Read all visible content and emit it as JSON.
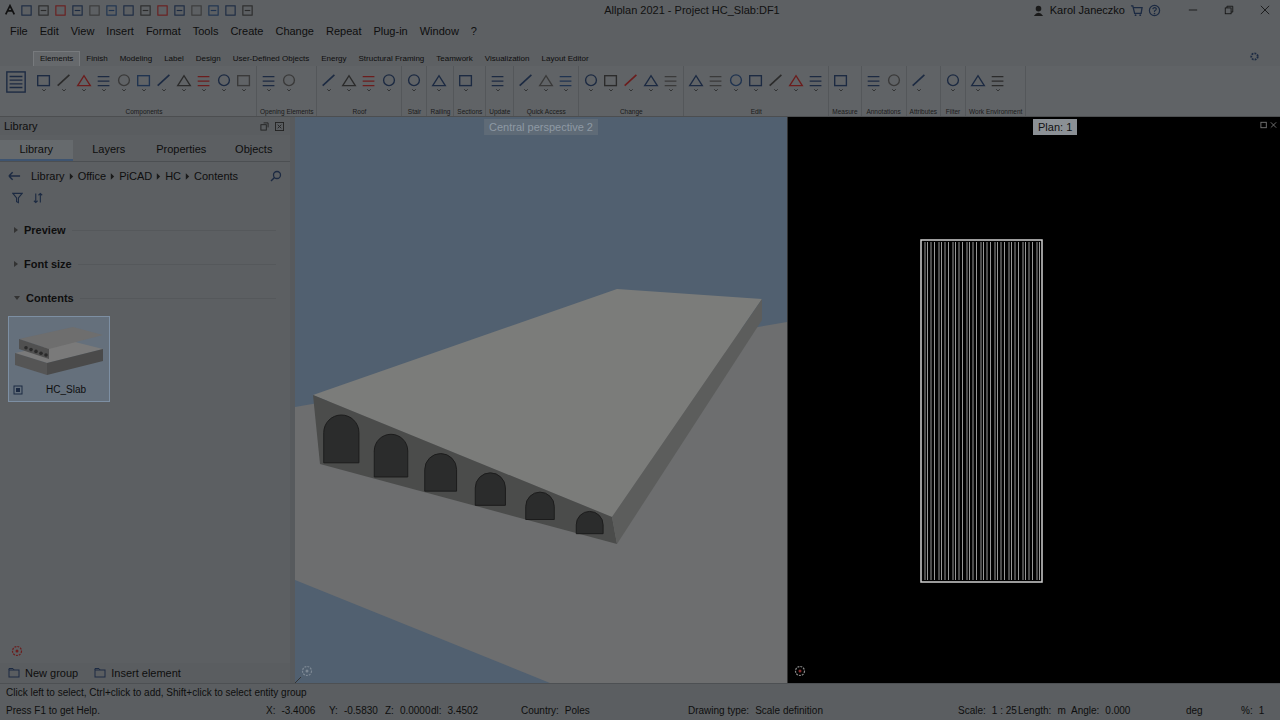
{
  "window": {
    "title": "Allplan 2021 - Project HC_Slab:DF1",
    "user": "Karol Janeczko"
  },
  "menu": [
    "File",
    "Edit",
    "View",
    "Insert",
    "Format",
    "Tools",
    "Create",
    "Change",
    "Repeat",
    "Plug-in",
    "Window",
    "?"
  ],
  "ribbon_tabs": [
    {
      "label": "Elements",
      "selected": true
    },
    {
      "label": "Finish",
      "selected": false
    },
    {
      "label": "Modeling",
      "selected": false
    },
    {
      "label": "Label",
      "selected": false
    },
    {
      "label": "Design",
      "selected": false
    },
    {
      "label": "User-Defined Objects",
      "selected": false
    },
    {
      "label": "Energy",
      "selected": false
    },
    {
      "label": "Structural Framing",
      "selected": false
    },
    {
      "label": "Teamwork",
      "selected": false
    },
    {
      "label": "Visualization",
      "selected": false
    },
    {
      "label": "Layout Editor",
      "selected": false
    }
  ],
  "ribbon_groups": [
    "Components",
    "Opening Elements",
    "Roof",
    "Stair",
    "Railing",
    "Sections",
    "Update",
    "Quick Access",
    "Change",
    "Edit",
    "Measure",
    "Annotations",
    "Attributes",
    "Filter",
    "Work Environment"
  ],
  "library_panel": {
    "title": "Library",
    "tabs": [
      {
        "label": "Library",
        "selected": true
      },
      {
        "label": "Layers",
        "selected": false
      },
      {
        "label": "Properties",
        "selected": false
      },
      {
        "label": "Objects",
        "selected": false
      }
    ],
    "breadcrumb": [
      "Library",
      "Office",
      "PiCAD",
      "HC",
      "Contents"
    ],
    "sections": [
      {
        "label": "Preview",
        "expanded": false
      },
      {
        "label": "Font size",
        "expanded": false
      },
      {
        "label": "Contents",
        "expanded": true
      }
    ],
    "items": [
      {
        "name": "HC_Slab",
        "selected": true
      }
    ],
    "buttons": [
      "New group",
      "Insert element"
    ]
  },
  "viewports": [
    {
      "label": "Central perspective 2",
      "kind": "perspective"
    },
    {
      "label": "Plan: 1",
      "kind": "plan"
    }
  ],
  "status_prompt": "Click left to select, Ctrl+click to add, Shift+click to select entity group",
  "status_bar": [
    {
      "label": "Press F1 to get Help.",
      "value": ""
    },
    {
      "label": "X:",
      "value": "-3.4006"
    },
    {
      "label": "Y:",
      "value": "-0.5830"
    },
    {
      "label": "Z:",
      "value": "0.0000"
    },
    {
      "label": "dl:",
      "value": "3.4502"
    },
    {
      "label": "Country:",
      "value": "Poles"
    },
    {
      "label": "Drawing type:",
      "value": "Scale definition"
    },
    {
      "label": "Scale:",
      "value": "1 : 25"
    },
    {
      "label": "Length:",
      "value": "m"
    },
    {
      "label": "Angle:",
      "value": "0.000"
    },
    {
      "label": "deg",
      "value": ""
    },
    {
      "label": "%:",
      "value": "1"
    }
  ]
}
